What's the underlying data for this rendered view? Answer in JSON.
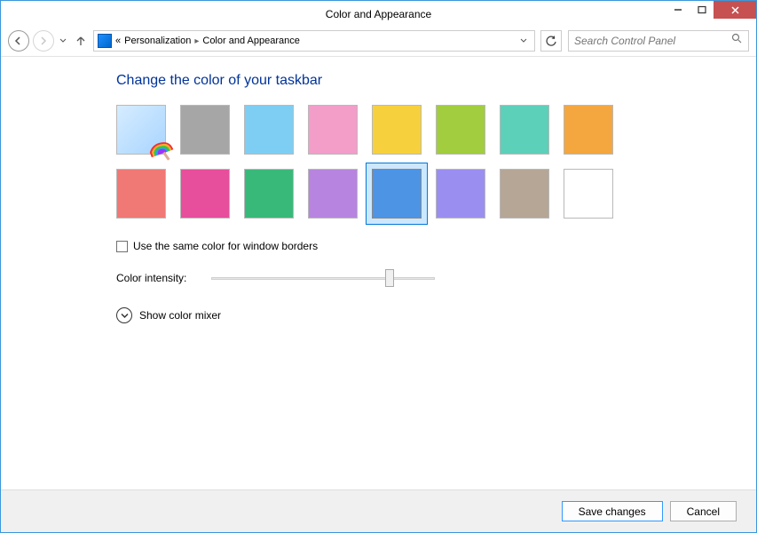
{
  "window": {
    "title": "Color and Appearance"
  },
  "breadcrumb": {
    "prefix": "«",
    "item1": "Personalization",
    "item2": "Color and Appearance"
  },
  "search": {
    "placeholder": "Search Control Panel"
  },
  "page": {
    "heading": "Change the color of your taskbar",
    "checkbox_label": "Use the same color for window borders",
    "slider_label": "Color intensity:",
    "expander_label": "Show color mixer"
  },
  "colors": {
    "swatches": [
      {
        "name": "automatic",
        "hex": "auto"
      },
      {
        "name": "gray",
        "hex": "#a6a6a6"
      },
      {
        "name": "sky-blue",
        "hex": "#7ecef4"
      },
      {
        "name": "pink",
        "hex": "#f29ec9"
      },
      {
        "name": "yellow",
        "hex": "#f6d13d"
      },
      {
        "name": "lime",
        "hex": "#a1cd3e"
      },
      {
        "name": "teal",
        "hex": "#5dd0b9"
      },
      {
        "name": "orange",
        "hex": "#f4a73e"
      },
      {
        "name": "coral",
        "hex": "#f07875"
      },
      {
        "name": "magenta",
        "hex": "#e74e9b"
      },
      {
        "name": "green",
        "hex": "#39b979"
      },
      {
        "name": "purple",
        "hex": "#b784e0"
      },
      {
        "name": "blue",
        "hex": "#4d94e5",
        "selected": true
      },
      {
        "name": "lavender",
        "hex": "#9a8ff0"
      },
      {
        "name": "taupe",
        "hex": "#b6a696"
      },
      {
        "name": "white",
        "hex": "#ffffff"
      }
    ],
    "slider_position_pct": 78
  },
  "footer": {
    "save": "Save changes",
    "cancel": "Cancel"
  }
}
